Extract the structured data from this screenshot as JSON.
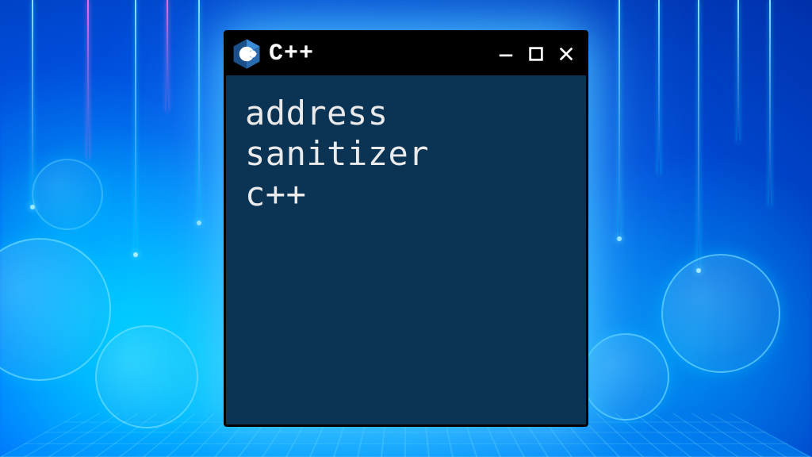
{
  "window": {
    "title": "C++",
    "icon": "cpp-logo-icon",
    "controls": {
      "minimize": "minimize-icon",
      "maximize": "maximize-icon",
      "close": "close-icon"
    }
  },
  "content": {
    "text": "address\nsanitizer\nc++"
  },
  "colors": {
    "titlebar_bg": "#000000",
    "content_bg": "#0b3354",
    "text": "#eaeaea",
    "accent_blue": "#2aa3ff"
  }
}
